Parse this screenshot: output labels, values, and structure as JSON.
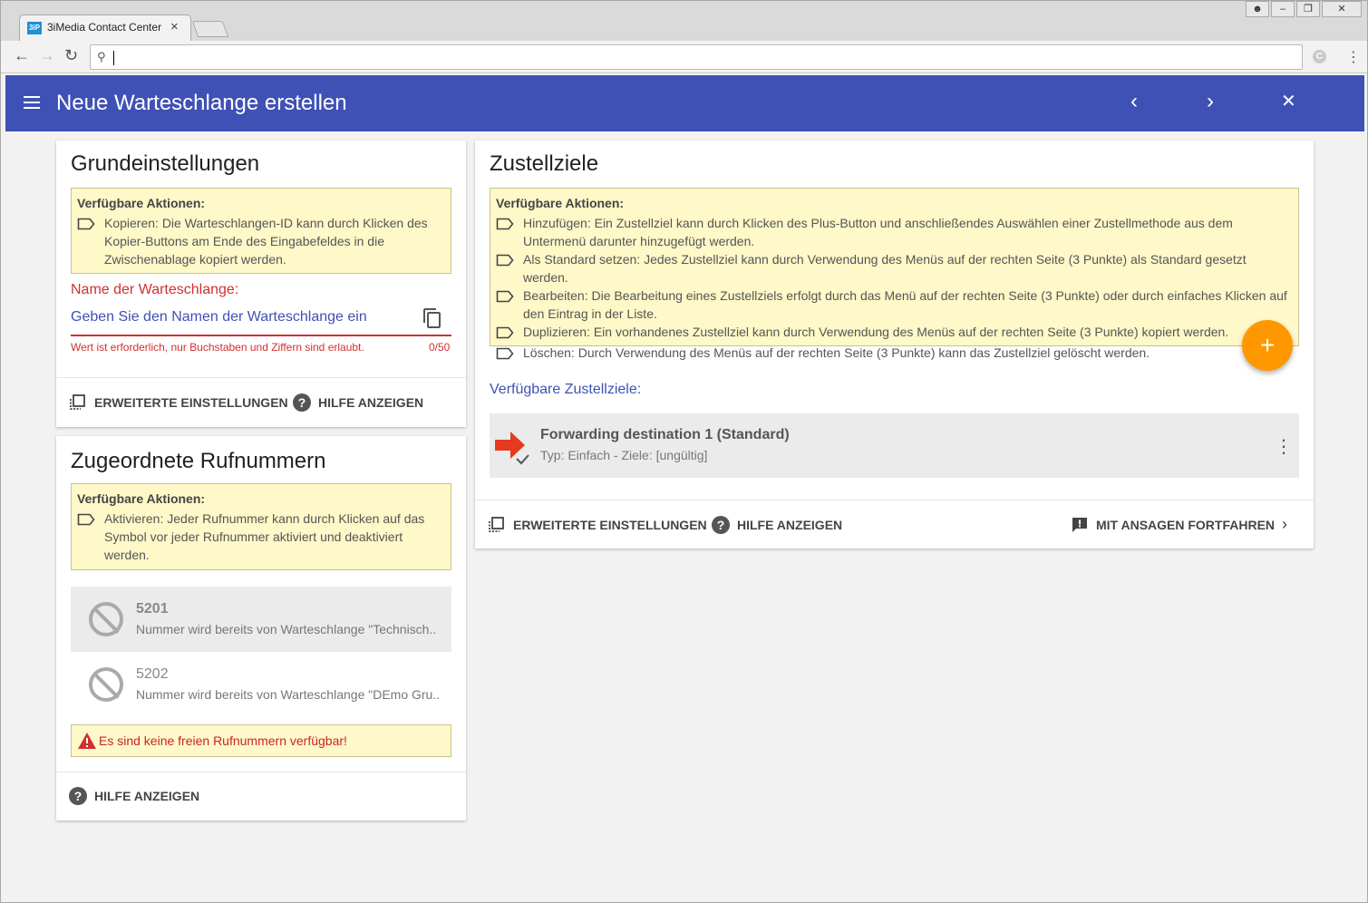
{
  "browser": {
    "tab_title": "3iMedia Contact Center",
    "tab_close": "×",
    "favicon_text": "3iP",
    "address_value": ""
  },
  "appbar": {
    "title": "Neue Warteschlange erstellen",
    "prev": "‹",
    "next": "›",
    "close": "✕",
    "color": "#3f51b5"
  },
  "basic": {
    "title": "Grundeinstellungen",
    "info_heading": "Verfügbare Aktionen:",
    "info_items": [
      "Kopieren: Die Warteschlangen-ID kann durch Klicken des Kopier-Buttons am Ende des Eingabefeldes in die Zwischenablage kopiert werden."
    ],
    "field_label": "Name der Warteschlange:",
    "field_placeholder": "Geben Sie den Namen der Warteschlange ein",
    "field_error": "Wert ist erforderlich, nur Buchstaben und Ziffern sind erlaubt.",
    "field_counter": "0/50",
    "advanced_label": "ERWEITERTE EINSTELLUNGEN",
    "help_label": "HILFE ANZEIGEN"
  },
  "numbers": {
    "title": "Zugeordnete Rufnummern",
    "info_heading": "Verfügbare Aktionen:",
    "info_items": [
      "Aktivieren: Jeder Rufnummer kann durch Klicken auf das Symbol vor jeder Rufnummer aktiviert und deaktiviert werden."
    ],
    "items": [
      {
        "number": "5201",
        "status": "Nummer wird bereits von Warteschlange \"Technisch.."
      },
      {
        "number": "5202",
        "status": "Nummer wird bereits von Warteschlange \"DEmo Gru.."
      }
    ],
    "warning": "Es sind keine freien Rufnummern verfügbar!",
    "help_label": "HILFE ANZEIGEN"
  },
  "destinations": {
    "title": "Zustellziele",
    "info_heading": "Verfügbare Aktionen:",
    "info_items": [
      "Hinzufügen: Ein Zustellziel kann durch Klicken des Plus-Button und anschließendes Auswählen einer Zustellmethode aus dem Untermenü darunter hinzugefügt werden.",
      "Als Standard setzen: Jedes Zustellziel kann durch Verwendung des Menüs auf der rechten Seite (3 Punkte) als Standard gesetzt werden.",
      "Bearbeiten: Die Bearbeitung eines Zustellziels erfolgt durch das Menü auf der rechten Seite (3 Punkte) oder durch einfaches Klicken auf den Eintrag in der Liste.",
      "Duplizieren: Ein vorhandenes Zustellziel kann durch Verwendung des Menüs auf der rechten Seite (3 Punkte) kopiert werden.",
      "Löschen: Durch Verwendung des Menüs auf der rechten Seite (3 Punkte) kann das Zustellziel gelöscht werden."
    ],
    "fab_label": "+",
    "available_label": "Verfügbare Zustellziele:",
    "items": [
      {
        "name": "Forwarding destination 1 (Standard)",
        "detail": "Typ: Einfach - Ziele: [ungültig]"
      }
    ],
    "advanced_label": "ERWEITERTE EINSTELLUNGEN",
    "help_label": "HILFE ANZEIGEN",
    "continue_label": "MIT ANSAGEN FORTFAHREN",
    "fab_color": "#ff9800",
    "arrow_color": "#e53a1e"
  }
}
